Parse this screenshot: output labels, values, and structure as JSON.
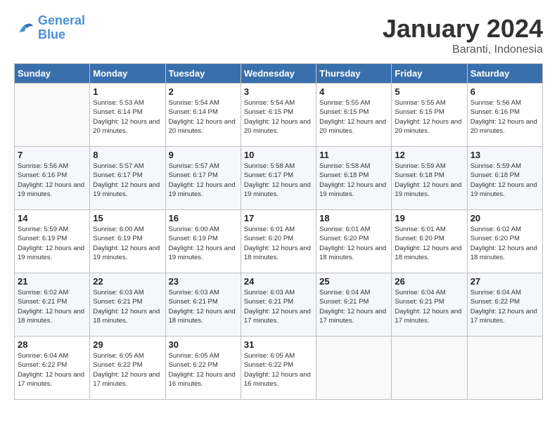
{
  "header": {
    "logo_line1": "General",
    "logo_line2": "Blue",
    "month_title": "January 2024",
    "subtitle": "Baranti, Indonesia"
  },
  "weekdays": [
    "Sunday",
    "Monday",
    "Tuesday",
    "Wednesday",
    "Thursday",
    "Friday",
    "Saturday"
  ],
  "weeks": [
    [
      {
        "day": "",
        "sunrise": "",
        "sunset": "",
        "daylight": ""
      },
      {
        "day": "1",
        "sunrise": "Sunrise: 5:53 AM",
        "sunset": "Sunset: 6:14 PM",
        "daylight": "Daylight: 12 hours and 20 minutes."
      },
      {
        "day": "2",
        "sunrise": "Sunrise: 5:54 AM",
        "sunset": "Sunset: 6:14 PM",
        "daylight": "Daylight: 12 hours and 20 minutes."
      },
      {
        "day": "3",
        "sunrise": "Sunrise: 5:54 AM",
        "sunset": "Sunset: 6:15 PM",
        "daylight": "Daylight: 12 hours and 20 minutes."
      },
      {
        "day": "4",
        "sunrise": "Sunrise: 5:55 AM",
        "sunset": "Sunset: 6:15 PM",
        "daylight": "Daylight: 12 hours and 20 minutes."
      },
      {
        "day": "5",
        "sunrise": "Sunrise: 5:55 AM",
        "sunset": "Sunset: 6:15 PM",
        "daylight": "Daylight: 12 hours and 20 minutes."
      },
      {
        "day": "6",
        "sunrise": "Sunrise: 5:56 AM",
        "sunset": "Sunset: 6:16 PM",
        "daylight": "Daylight: 12 hours and 20 minutes."
      }
    ],
    [
      {
        "day": "7",
        "sunrise": "Sunrise: 5:56 AM",
        "sunset": "Sunset: 6:16 PM",
        "daylight": "Daylight: 12 hours and 19 minutes."
      },
      {
        "day": "8",
        "sunrise": "Sunrise: 5:57 AM",
        "sunset": "Sunset: 6:17 PM",
        "daylight": "Daylight: 12 hours and 19 minutes."
      },
      {
        "day": "9",
        "sunrise": "Sunrise: 5:57 AM",
        "sunset": "Sunset: 6:17 PM",
        "daylight": "Daylight: 12 hours and 19 minutes."
      },
      {
        "day": "10",
        "sunrise": "Sunrise: 5:58 AM",
        "sunset": "Sunset: 6:17 PM",
        "daylight": "Daylight: 12 hours and 19 minutes."
      },
      {
        "day": "11",
        "sunrise": "Sunrise: 5:58 AM",
        "sunset": "Sunset: 6:18 PM",
        "daylight": "Daylight: 12 hours and 19 minutes."
      },
      {
        "day": "12",
        "sunrise": "Sunrise: 5:59 AM",
        "sunset": "Sunset: 6:18 PM",
        "daylight": "Daylight: 12 hours and 19 minutes."
      },
      {
        "day": "13",
        "sunrise": "Sunrise: 5:59 AM",
        "sunset": "Sunset: 6:18 PM",
        "daylight": "Daylight: 12 hours and 19 minutes."
      }
    ],
    [
      {
        "day": "14",
        "sunrise": "Sunrise: 5:59 AM",
        "sunset": "Sunset: 6:19 PM",
        "daylight": "Daylight: 12 hours and 19 minutes."
      },
      {
        "day": "15",
        "sunrise": "Sunrise: 6:00 AM",
        "sunset": "Sunset: 6:19 PM",
        "daylight": "Daylight: 12 hours and 19 minutes."
      },
      {
        "day": "16",
        "sunrise": "Sunrise: 6:00 AM",
        "sunset": "Sunset: 6:19 PM",
        "daylight": "Daylight: 12 hours and 19 minutes."
      },
      {
        "day": "17",
        "sunrise": "Sunrise: 6:01 AM",
        "sunset": "Sunset: 6:20 PM",
        "daylight": "Daylight: 12 hours and 18 minutes."
      },
      {
        "day": "18",
        "sunrise": "Sunrise: 6:01 AM",
        "sunset": "Sunset: 6:20 PM",
        "daylight": "Daylight: 12 hours and 18 minutes."
      },
      {
        "day": "19",
        "sunrise": "Sunrise: 6:01 AM",
        "sunset": "Sunset: 6:20 PM",
        "daylight": "Daylight: 12 hours and 18 minutes."
      },
      {
        "day": "20",
        "sunrise": "Sunrise: 6:02 AM",
        "sunset": "Sunset: 6:20 PM",
        "daylight": "Daylight: 12 hours and 18 minutes."
      }
    ],
    [
      {
        "day": "21",
        "sunrise": "Sunrise: 6:02 AM",
        "sunset": "Sunset: 6:21 PM",
        "daylight": "Daylight: 12 hours and 18 minutes."
      },
      {
        "day": "22",
        "sunrise": "Sunrise: 6:03 AM",
        "sunset": "Sunset: 6:21 PM",
        "daylight": "Daylight: 12 hours and 18 minutes."
      },
      {
        "day": "23",
        "sunrise": "Sunrise: 6:03 AM",
        "sunset": "Sunset: 6:21 PM",
        "daylight": "Daylight: 12 hours and 18 minutes."
      },
      {
        "day": "24",
        "sunrise": "Sunrise: 6:03 AM",
        "sunset": "Sunset: 6:21 PM",
        "daylight": "Daylight: 12 hours and 17 minutes."
      },
      {
        "day": "25",
        "sunrise": "Sunrise: 6:04 AM",
        "sunset": "Sunset: 6:21 PM",
        "daylight": "Daylight: 12 hours and 17 minutes."
      },
      {
        "day": "26",
        "sunrise": "Sunrise: 6:04 AM",
        "sunset": "Sunset: 6:21 PM",
        "daylight": "Daylight: 12 hours and 17 minutes."
      },
      {
        "day": "27",
        "sunrise": "Sunrise: 6:04 AM",
        "sunset": "Sunset: 6:22 PM",
        "daylight": "Daylight: 12 hours and 17 minutes."
      }
    ],
    [
      {
        "day": "28",
        "sunrise": "Sunrise: 6:04 AM",
        "sunset": "Sunset: 6:22 PM",
        "daylight": "Daylight: 12 hours and 17 minutes."
      },
      {
        "day": "29",
        "sunrise": "Sunrise: 6:05 AM",
        "sunset": "Sunset: 6:22 PM",
        "daylight": "Daylight: 12 hours and 17 minutes."
      },
      {
        "day": "30",
        "sunrise": "Sunrise: 6:05 AM",
        "sunset": "Sunset: 6:22 PM",
        "daylight": "Daylight: 12 hours and 16 minutes."
      },
      {
        "day": "31",
        "sunrise": "Sunrise: 6:05 AM",
        "sunset": "Sunset: 6:22 PM",
        "daylight": "Daylight: 12 hours and 16 minutes."
      },
      {
        "day": "",
        "sunrise": "",
        "sunset": "",
        "daylight": ""
      },
      {
        "day": "",
        "sunrise": "",
        "sunset": "",
        "daylight": ""
      },
      {
        "day": "",
        "sunrise": "",
        "sunset": "",
        "daylight": ""
      }
    ]
  ]
}
